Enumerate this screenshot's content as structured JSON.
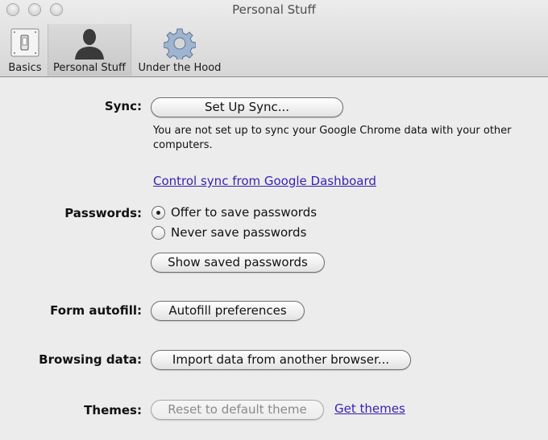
{
  "window": {
    "title": "Personal Stuff",
    "controls": [
      "close",
      "minimize",
      "zoom"
    ]
  },
  "toolbar": {
    "items": [
      {
        "label": "Basics",
        "icon": "light-switch-icon",
        "selected": false
      },
      {
        "label": "Personal Stuff",
        "icon": "person-silhouette-icon",
        "selected": true
      },
      {
        "label": "Under the Hood",
        "icon": "gear-icon",
        "selected": false
      }
    ]
  },
  "sync": {
    "label": "Sync:",
    "button": "Set Up Sync...",
    "description": "You are not set up to sync your Google Chrome data with your other computers.",
    "link": "Control sync from Google Dashboard"
  },
  "passwords": {
    "label": "Passwords:",
    "options": [
      {
        "label": "Offer to save passwords",
        "selected": true
      },
      {
        "label": "Never save passwords",
        "selected": false
      }
    ],
    "button": "Show saved passwords"
  },
  "autofill": {
    "label": "Form autofill:",
    "button": "Autofill preferences"
  },
  "browsing": {
    "label": "Browsing data:",
    "button": "Import data from another browser..."
  },
  "themes": {
    "label": "Themes:",
    "button": "Reset to default theme",
    "button_disabled": true,
    "link": "Get themes"
  },
  "colors": {
    "link": "#3a1fb0",
    "background": "#ececec"
  }
}
